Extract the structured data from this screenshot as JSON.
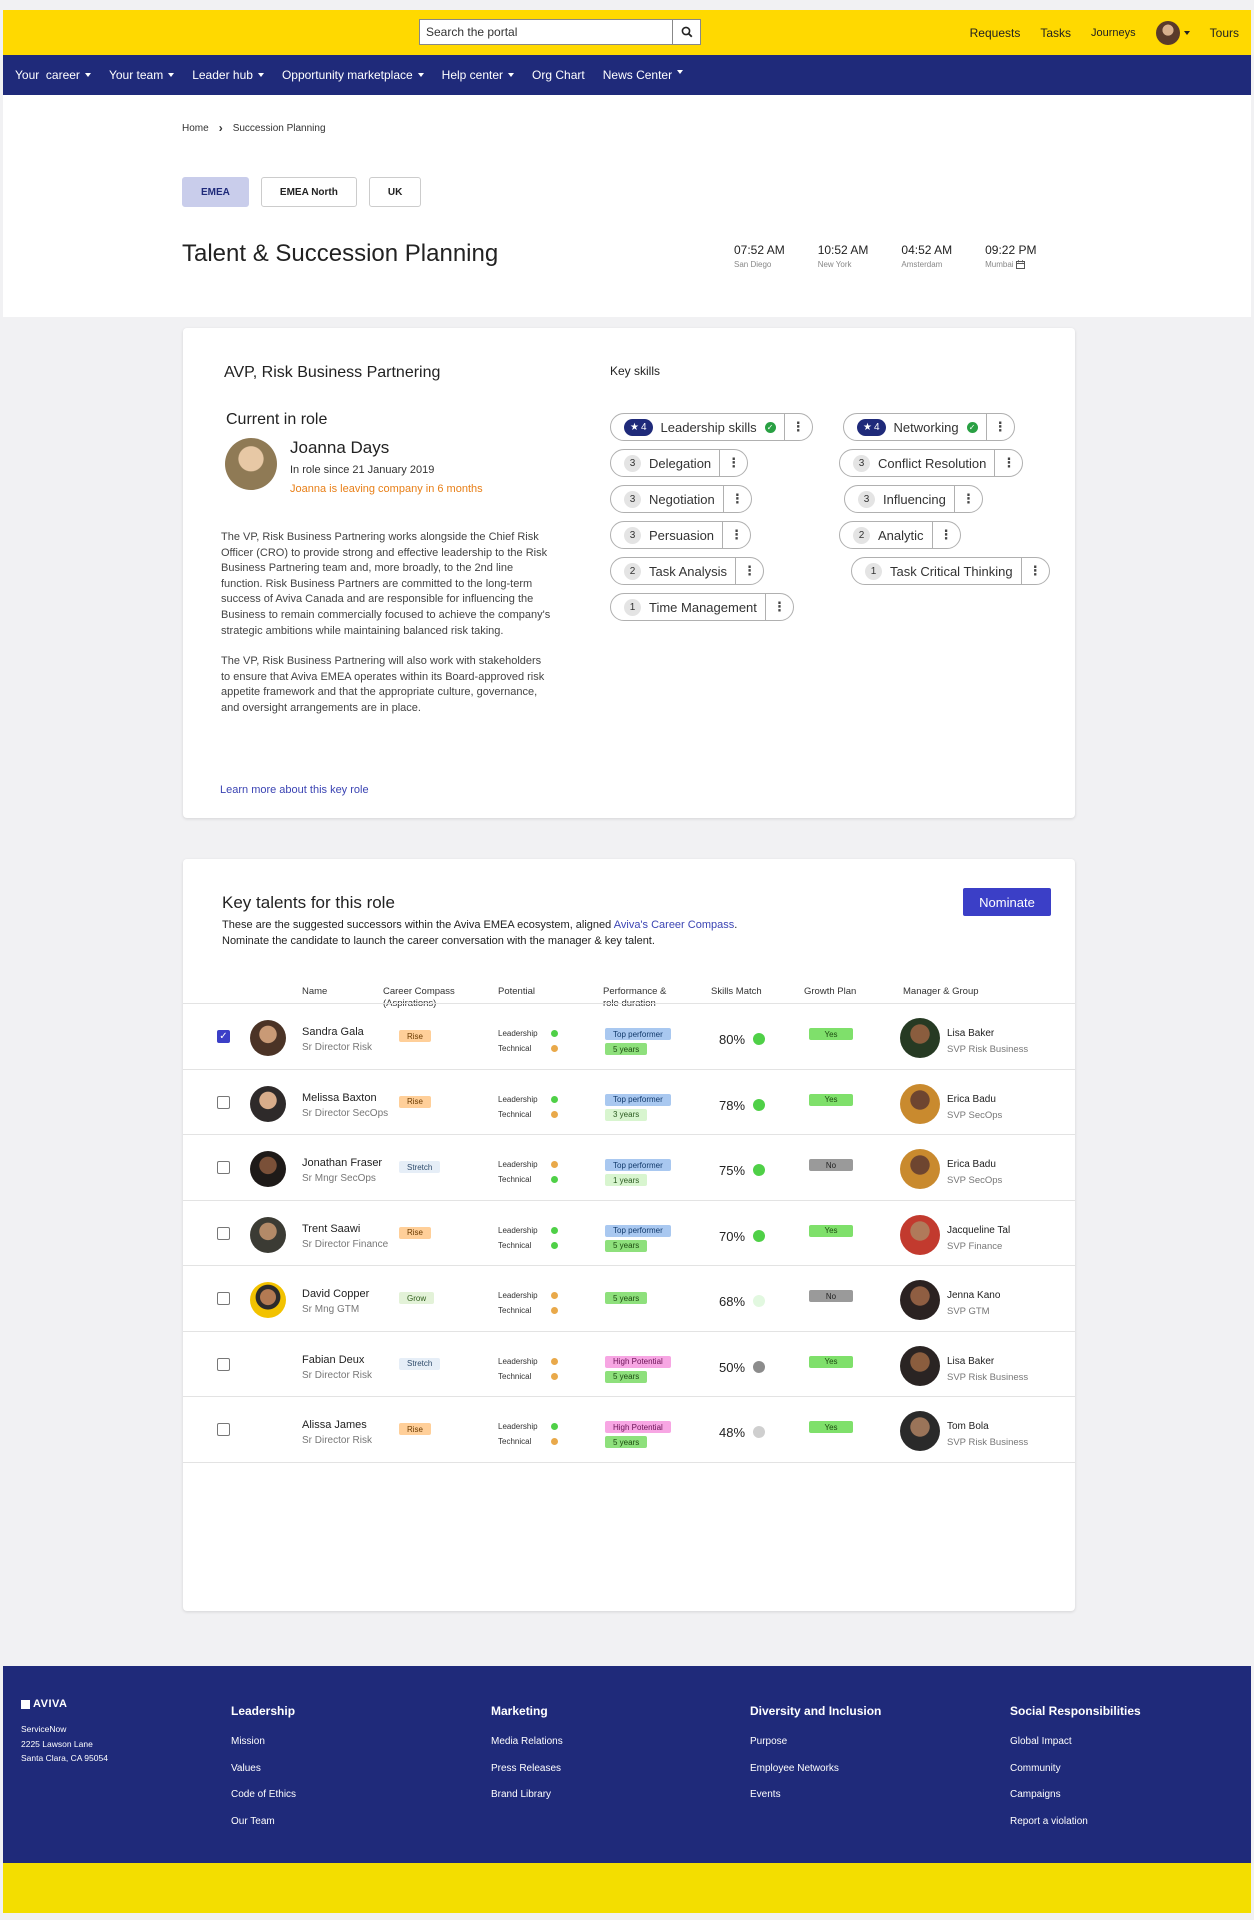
{
  "topbar": {
    "search_placeholder": "Search the portal",
    "links": [
      "Requests",
      "Tasks",
      "Journeys"
    ],
    "tours_label": "Tours"
  },
  "nav": {
    "items": [
      {
        "label": "Your  career",
        "dropdown": true
      },
      {
        "label": "Your team",
        "dropdown": true
      },
      {
        "label": "Leader hub",
        "dropdown": true
      },
      {
        "label": "Opportunity marketplace",
        "dropdown": true
      },
      {
        "label": "Help center",
        "dropdown": true
      },
      {
        "label": "Org Chart",
        "dropdown": false
      },
      {
        "label": "News Center",
        "dropdown": true
      }
    ]
  },
  "breadcrumb": {
    "home": "Home",
    "current": "Succession Planning"
  },
  "region_tabs": [
    {
      "label": "EMEA",
      "active": true
    },
    {
      "label": "EMEA North",
      "active": false
    },
    {
      "label": "UK",
      "active": false
    }
  ],
  "page_title": "Talent & Succession Planning",
  "clocks": [
    {
      "time": "07:52 AM",
      "city": "San Diego"
    },
    {
      "time": "10:52 AM",
      "city": "New York"
    },
    {
      "time": "04:52 AM",
      "city": "Amsterdam"
    },
    {
      "time": "09:22 PM",
      "city": "Mumbai"
    }
  ],
  "role": {
    "title": "AVP, Risk Business Partnering",
    "current_heading": "Current in role",
    "incumbent_name": "Joanna Days",
    "incumbent_since": "In role since 21 January 2019",
    "incumbent_alert": "Joanna is leaving company in 6 months",
    "desc1": "The VP, Risk Business Partnering works alongside the Chief Risk Officer (CRO) to provide strong and effective leadership to the Risk Business Partnering team and, more broadly, to the 2nd line function. Risk Business Partners are committed to the long-term success of Aviva Canada and are responsible for influencing the Business to remain commercially focused to achieve the company's strategic ambitions while maintaining balanced risk taking.",
    "desc2": "The VP, Risk Business Partnering will also work with stakeholders to ensure that Aviva EMEA operates within its Board-approved risk appetite framework and that the appropriate culture, governance, and oversight arrangements are in place.",
    "learn_more": "Learn more about this key role"
  },
  "skills": {
    "title": "Key skills",
    "items": [
      {
        "name": "Leadership skills",
        "level": "4",
        "starred": true,
        "verified": true
      },
      {
        "name": "Networking",
        "level": "4",
        "starred": true,
        "verified": true
      },
      {
        "name": "Delegation",
        "level": "3",
        "starred": false,
        "verified": false
      },
      {
        "name": "Conflict Resolution",
        "level": "3",
        "starred": false,
        "verified": false
      },
      {
        "name": "Negotiation",
        "level": "3",
        "starred": false,
        "verified": false
      },
      {
        "name": "Influencing",
        "level": "3",
        "starred": false,
        "verified": false
      },
      {
        "name": "Persuasion",
        "level": "3",
        "starred": false,
        "verified": false
      },
      {
        "name": "Analytic",
        "level": "2",
        "starred": false,
        "verified": false
      },
      {
        "name": "Task Analysis",
        "level": "2",
        "starred": false,
        "verified": false
      },
      {
        "name": "Task Critical Thinking",
        "level": "1",
        "starred": false,
        "verified": false
      },
      {
        "name": "Time Management",
        "level": "1",
        "starred": false,
        "verified": false
      }
    ]
  },
  "talents": {
    "title": "Key talents for this role",
    "desc_prefix": "These are the suggested successors within the Aviva EMEA ecosystem, aligned ",
    "desc_link": "Aviva's Career Compass",
    "desc_suffix": ".",
    "desc_line2": "Nominate the candidate to launch the career conversation with the manager & key talent.",
    "nominate_label": "Nominate",
    "columns": {
      "name": "Name",
      "compass1": "Career Compass",
      "compass2": "(Aspirations)",
      "potential": "Potential",
      "perf1": "Performance &",
      "perf2": "role duration",
      "skills": "Skills Match",
      "growth": "Growth Plan",
      "manager": "Manager & Group"
    },
    "potential_labels": {
      "leadership": "Leadership",
      "technical": "Technical"
    },
    "colors": {
      "green": "#4fd047",
      "orange": "#e9a94a",
      "grey": "#8c8c8c",
      "light_grey": "#cfcfcf",
      "pale_green": "#e2f8e0"
    },
    "rows": [
      {
        "checked": true,
        "name": "Sandra Gala",
        "title": "Sr Director Risk",
        "aspiration": "Rise",
        "lead": "green",
        "tech": "orange",
        "perf": "Top performer",
        "duration": "5 years",
        "match": "80%",
        "match_color": "green",
        "growth": "Yes",
        "manager": "Lisa Baker",
        "group": "SVP Risk Business",
        "has_avatar": true
      },
      {
        "checked": false,
        "name": "Melissa Baxton",
        "title": "Sr Director SecOps",
        "aspiration": "Rise",
        "lead": "green",
        "tech": "orange",
        "perf": "Top performer",
        "duration": "3 years",
        "match": "78%",
        "match_color": "green",
        "growth": "Yes",
        "manager": "Erica Badu",
        "group": "SVP SecOps",
        "has_avatar": true
      },
      {
        "checked": false,
        "name": "Jonathan Fraser",
        "title": "Sr Mngr SecOps",
        "aspiration": "Stretch",
        "lead": "orange",
        "tech": "green",
        "perf": "Top performer",
        "duration": "1 years",
        "match": "75%",
        "match_color": "green",
        "growth": "No",
        "manager": "Erica Badu",
        "group": "SVP SecOps",
        "has_avatar": true
      },
      {
        "checked": false,
        "name": "Trent Saawi",
        "title": "Sr Director Finance",
        "aspiration": "Rise",
        "lead": "green",
        "tech": "green",
        "perf": "Top performer",
        "duration": "5 years",
        "match": "70%",
        "match_color": "green",
        "growth": "Yes",
        "manager": "Jacqueline Tal",
        "group": "SVP Finance",
        "has_avatar": true
      },
      {
        "checked": false,
        "name": "David Copper",
        "title": "Sr Mng GTM",
        "aspiration": "Grow",
        "lead": "orange",
        "tech": "orange",
        "perf": "",
        "duration": "5 years",
        "match": "68%",
        "match_color": "pale_green",
        "growth": "No",
        "manager": "Jenna Kano",
        "group": "SVP GTM",
        "has_avatar": true
      },
      {
        "checked": false,
        "name": "Fabian Deux",
        "title": "Sr Director Risk",
        "aspiration": "Stretch",
        "lead": "orange",
        "tech": "orange",
        "perf": "High Potential",
        "duration": "5 years",
        "match": "50%",
        "match_color": "grey",
        "growth": "Yes",
        "manager": "Lisa Baker",
        "group": "SVP Risk Business",
        "has_avatar": false
      },
      {
        "checked": false,
        "name": "Alissa James",
        "title": "Sr Director Risk",
        "aspiration": "Rise",
        "lead": "green",
        "tech": "orange",
        "perf": "High Potential",
        "duration": "5 years",
        "match": "48%",
        "match_color": "light_grey",
        "growth": "Yes",
        "manager": "Tom Bola",
        "group": "SVP Risk Business",
        "has_avatar": false
      }
    ]
  },
  "footer": {
    "logo": "AVIVA",
    "address": [
      "ServiceNow",
      "2225 Lawson Lane",
      "Santa Clara, CA 95054"
    ],
    "columns": [
      {
        "title": "Leadership",
        "links": [
          "Mission",
          "Values",
          "Code of Ethics",
          "Our Team"
        ]
      },
      {
        "title": "Marketing",
        "links": [
          "Media Relations",
          "Press Releases",
          "Brand Library"
        ]
      },
      {
        "title": "Diversity and Inclusion",
        "links": [
          "Purpose",
          "Employee Networks",
          "Events"
        ]
      },
      {
        "title": "Social Responsibilities",
        "links": [
          "Global Impact",
          "Community",
          "Campaigns",
          "Report a violation"
        ]
      }
    ]
  }
}
